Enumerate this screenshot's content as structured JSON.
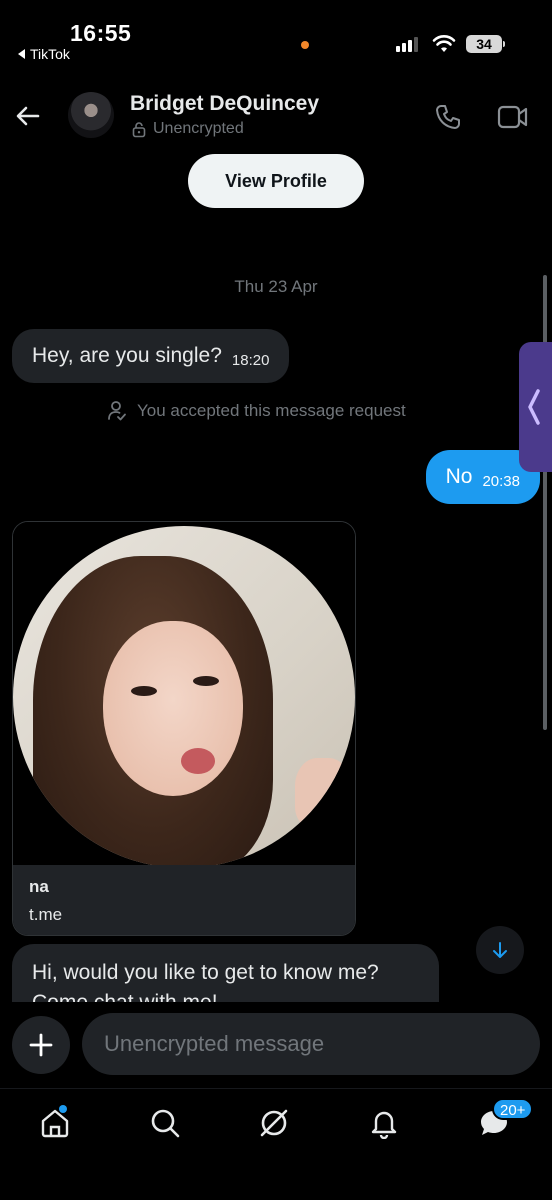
{
  "status_bar": {
    "time": "16:55",
    "back_app": "TikTok",
    "battery": "34"
  },
  "header": {
    "contact_name": "Bridget DeQuincey",
    "encryption_status": "Unencrypted"
  },
  "view_profile_label": "View Profile",
  "date_divider": "Thu 23 Apr",
  "messages": [
    {
      "direction": "incoming",
      "text": "Hey, are you single?",
      "time": "18:20"
    },
    {
      "direction": "outgoing",
      "text": "No",
      "time": "20:38"
    },
    {
      "direction": "incoming",
      "text": "Hi, would you like to get to know me? Come chat with me!"
    }
  ],
  "system_note": "You accepted this message request",
  "link_card": {
    "title": "na",
    "domain": "t.me"
  },
  "composer": {
    "placeholder": "Unencrypted message"
  },
  "nav": {
    "items": [
      "home-icon",
      "search-icon",
      "grok-icon",
      "notifications-icon",
      "messages-icon"
    ],
    "messages_badge": "20+"
  },
  "colors": {
    "accent": "#1d9bf0",
    "bubble_incoming": "#202327",
    "background": "#000000",
    "side_tab": "#4b3a8c"
  }
}
